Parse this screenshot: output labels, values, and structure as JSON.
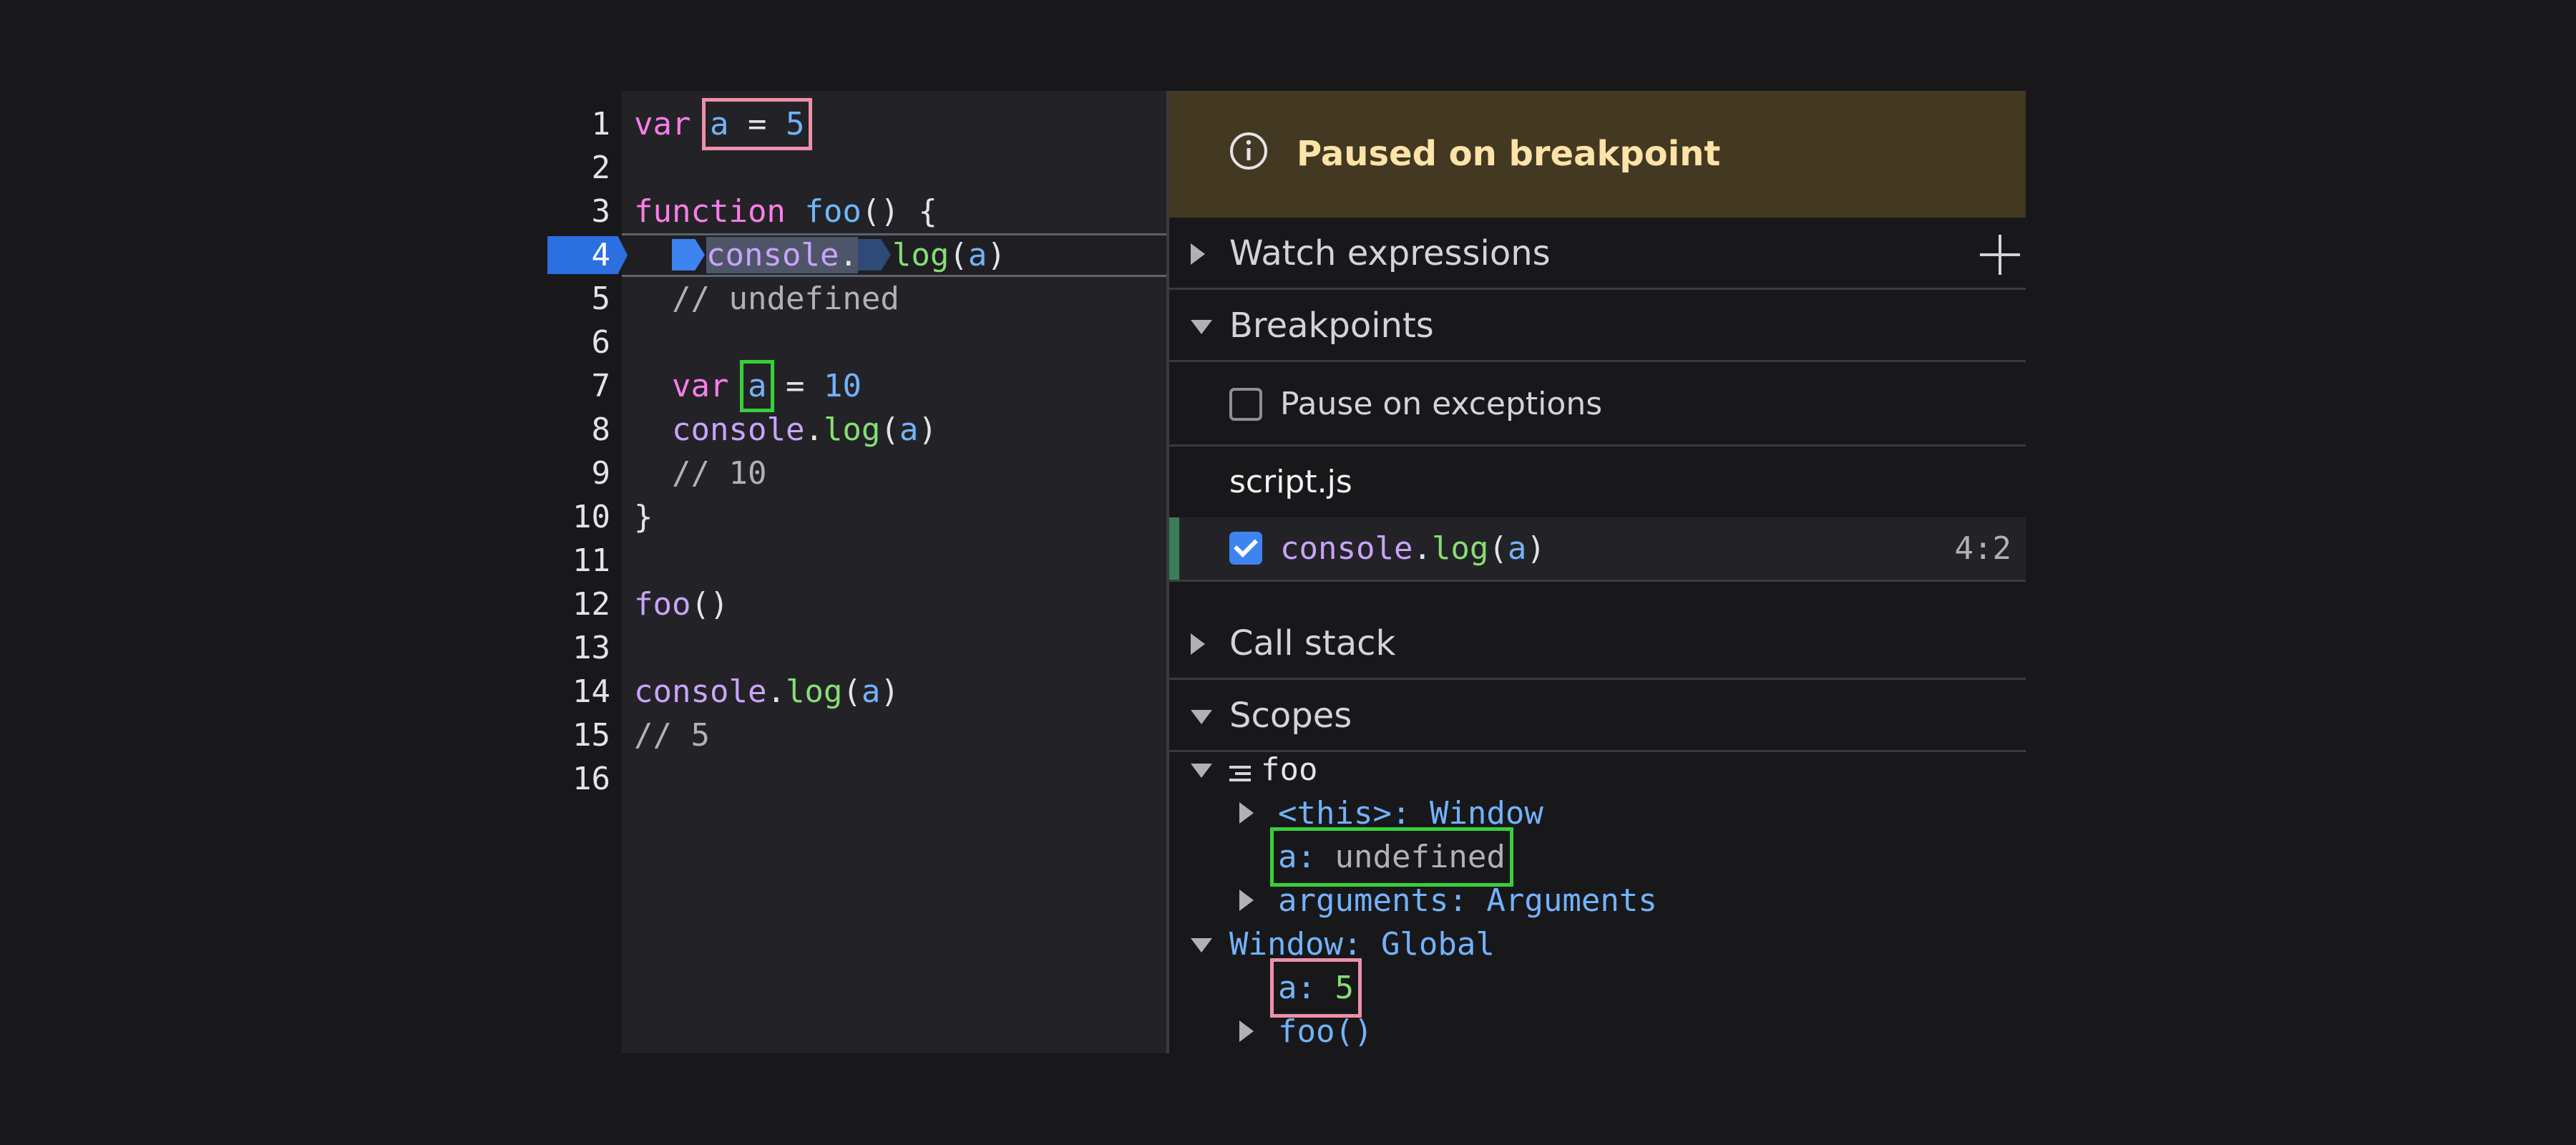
{
  "editor": {
    "lines": [
      {
        "num": "1"
      },
      {
        "num": "2"
      },
      {
        "num": "3"
      },
      {
        "num": "4"
      },
      {
        "num": "5"
      },
      {
        "num": "6"
      },
      {
        "num": "7"
      },
      {
        "num": "8"
      },
      {
        "num": "9"
      },
      {
        "num": "10"
      },
      {
        "num": "11"
      },
      {
        "num": "12"
      },
      {
        "num": "13"
      },
      {
        "num": "14"
      },
      {
        "num": "15"
      },
      {
        "num": "16"
      }
    ],
    "tokens": {
      "var": "var",
      "a": "a",
      "eq": "=",
      "five": "5",
      "ten": "10",
      "function": "function",
      "foo": "foo",
      "parens_brace": "() {",
      "console": "console",
      "dot": ".",
      "log": "log",
      "open_paren": "(",
      "close_paren": ")",
      "close_brace": "}",
      "call_parens": "()",
      "comment_undefined": "// undefined",
      "comment_10": "// 10",
      "comment_5": "// 5"
    }
  },
  "panel": {
    "paused_text": "Paused on breakpoint",
    "watch_label": "Watch expressions",
    "breakpoints_label": "Breakpoints",
    "pause_exceptions_label": "Pause on exceptions",
    "file_name": "script.js",
    "bp_console": "console",
    "bp_dot": ".",
    "bp_log": "log",
    "bp_open": "(",
    "bp_arg": "a",
    "bp_close": ")",
    "bp_location": "4:2",
    "callstack_label": "Call stack",
    "scopes_label": "Scopes",
    "scopes": {
      "foo_label": "foo",
      "this_key": "<this>",
      "this_value": "Window",
      "a_key": "a",
      "a_value_undefined": "undefined",
      "arguments_key": "arguments",
      "arguments_value": "Arguments",
      "window_key": "Window",
      "window_value": "Global",
      "global_a_key": "a",
      "global_a_value": "5",
      "foo_fn": "foo()",
      "colon": ": "
    }
  },
  "colors": {
    "breakpoint_blue": "#2b6fe0",
    "paused_banner": "#433922",
    "highlight_pink": "#ef8fa9",
    "highlight_green": "#37d03a"
  }
}
